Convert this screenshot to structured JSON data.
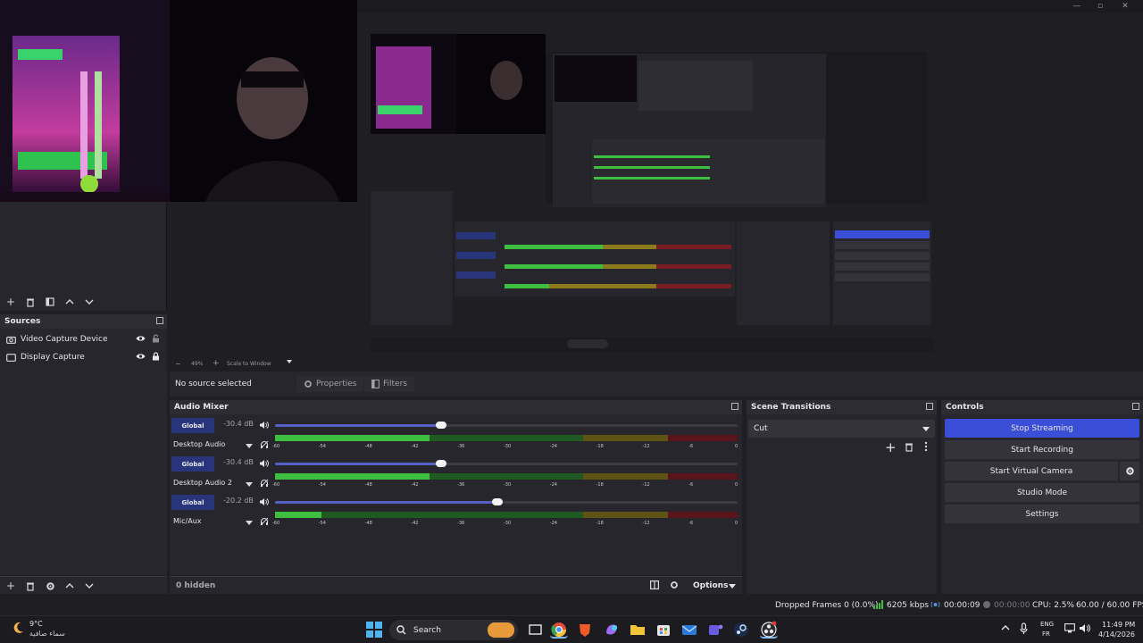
{
  "sources": {
    "title": "Sources",
    "items": [
      {
        "name": "Video Capture Device"
      },
      {
        "name": "Display Capture"
      }
    ]
  },
  "zoom_bar": {
    "zoom": "49%",
    "scale_mode": "Scale to Window"
  },
  "context": {
    "selection": "No source selected",
    "properties_label": "Properties",
    "filters_label": "Filters"
  },
  "mixer": {
    "title": "Audio Mixer",
    "global_label": "Global",
    "channels": [
      {
        "name": "Desktop Audio",
        "db": "-30.4 dB",
        "volume": 0.36,
        "level_db": -40
      },
      {
        "name": "Desktop Audio 2",
        "db": "-30.4 dB",
        "volume": 0.36,
        "level_db": -40
      },
      {
        "name": "Mic/Aux",
        "db": "-20.2 dB",
        "volume": 0.48,
        "level_db": -54
      }
    ],
    "scale_ticks": [
      "-60",
      "-54",
      "-48",
      "-42",
      "-36",
      "-30",
      "-24",
      "-18",
      "-12",
      "-6",
      "0"
    ],
    "hidden_count": "0 hidden",
    "options_label": "Options"
  },
  "transitions": {
    "title": "Scene Transitions",
    "selected": "Cut"
  },
  "controls": {
    "title": "Controls",
    "buttons": [
      "Stop Streaming",
      "Start Recording",
      "Start Virtual Camera",
      "Studio Mode",
      "Settings"
    ]
  },
  "status": {
    "dropped_frames": "Dropped Frames 0 (0.0%)",
    "bitrate": "6205 kbps",
    "stream_time": "00:00:09",
    "record_time": "00:00:00",
    "cpu": "CPU: 2.5%",
    "fps": "60.00 / 60.00 FPS"
  },
  "taskbar": {
    "weather_temp": "9°C",
    "weather_desc": "سماء صافية",
    "search_placeholder": "Search",
    "lang_top": "ENG",
    "lang_bottom": "FR",
    "time": "11:49 PM",
    "date": "4/14/2026"
  },
  "colors": {
    "accent": "#3a4ed8",
    "meter_green": "#3fbf3f",
    "meter_yellow": "#8c7a1c",
    "meter_red": "#7a1c24"
  }
}
